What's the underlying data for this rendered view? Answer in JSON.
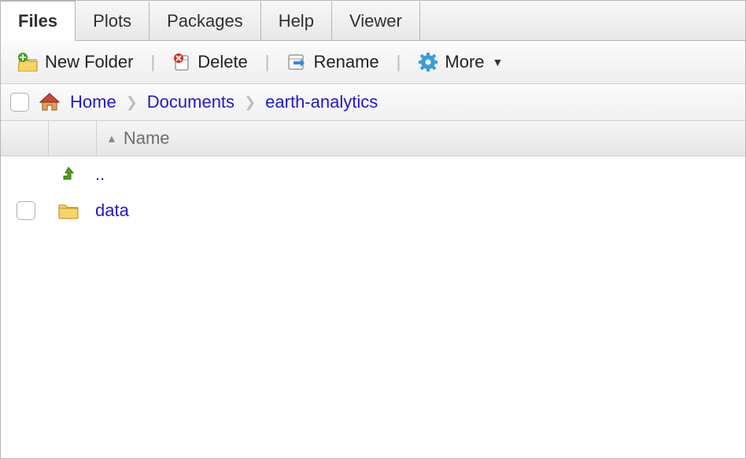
{
  "tabs": [
    "Files",
    "Plots",
    "Packages",
    "Help",
    "Viewer"
  ],
  "active_tab": 0,
  "toolbar": {
    "new_folder": "New Folder",
    "delete": "Delete",
    "rename": "Rename",
    "more": "More"
  },
  "breadcrumb": [
    "Home",
    "Documents",
    "earth-analytics"
  ],
  "columns": {
    "name": "Name"
  },
  "rows": {
    "up": "..",
    "items": [
      {
        "name": "data",
        "type": "folder"
      }
    ]
  }
}
